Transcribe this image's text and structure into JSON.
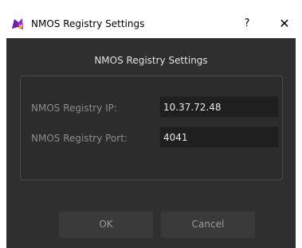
{
  "window": {
    "title": "NMOS Registry Settings",
    "help_glyph": "?",
    "close_glyph": "✕",
    "app_icon": "colorful-puzzle-app-icon"
  },
  "dialog": {
    "heading": "NMOS Registry Settings",
    "ip_label": "NMOS Registry IP:",
    "ip_value": "10.37.72.48",
    "port_label": "NMOS Registry Port:",
    "port_value": "4041",
    "ok_label": "OK",
    "cancel_label": "Cancel"
  }
}
